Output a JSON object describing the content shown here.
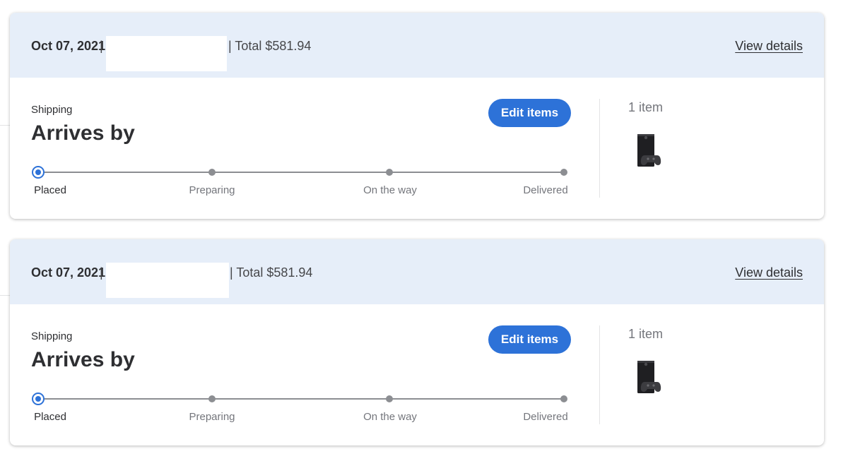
{
  "orders": [
    {
      "date": "Oct 07, 2021",
      "separator_left": "|",
      "total": "| Total $581.94",
      "view_details": "View details",
      "fulfillment": "Shipping",
      "arrives_title": "Arrives by",
      "edit_button": "Edit items",
      "steps": [
        "Placed",
        "Preparing",
        "On the way",
        "Delivered"
      ],
      "current_step": 0,
      "item_count": "1 item"
    },
    {
      "date": "Oct 07, 2021",
      "separator_left": "|",
      "total": "| Total $581.94",
      "view_details": "View details",
      "fulfillment": "Shipping",
      "arrives_title": "Arrives by",
      "edit_button": "Edit items",
      "steps": [
        "Placed",
        "Preparing",
        "On the way",
        "Delivered"
      ],
      "current_step": 0,
      "item_count": "1 item"
    }
  ],
  "colors": {
    "header_bg": "#e6eef9",
    "accent": "#2d72d8",
    "track": "#8c8e92"
  },
  "icons": {
    "product_thumbnail": "game-console-icon"
  }
}
